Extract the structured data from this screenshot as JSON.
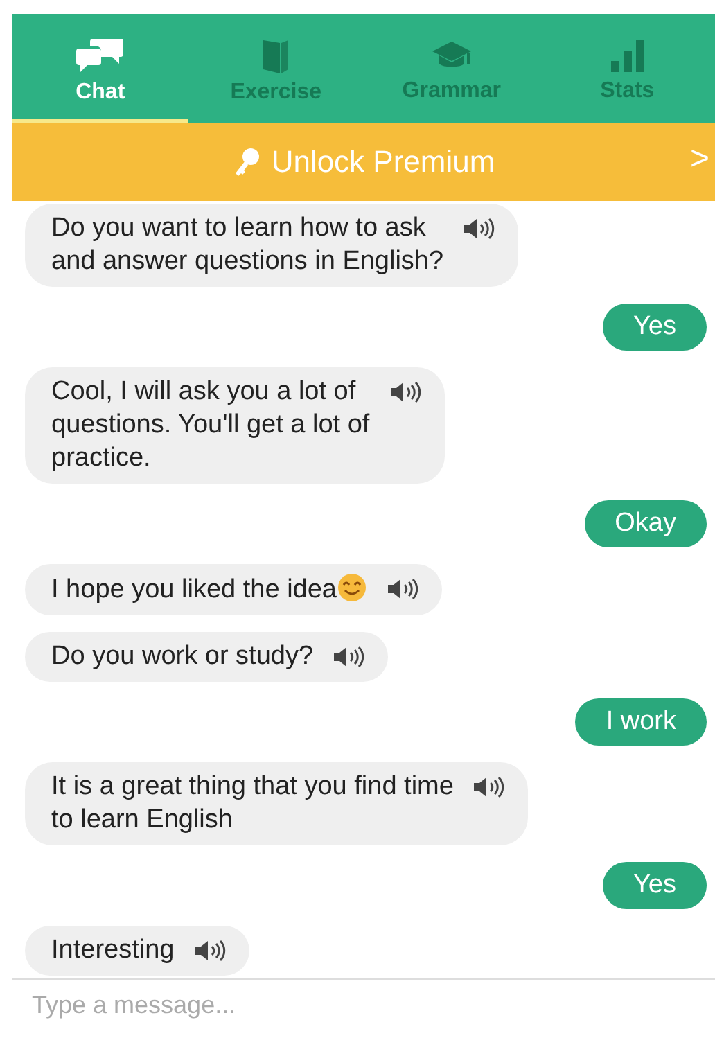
{
  "tabs": [
    {
      "label": "Chat",
      "selected": true
    },
    {
      "label": "Exercise",
      "selected": false
    },
    {
      "label": "Grammar",
      "selected": false
    },
    {
      "label": "Stats",
      "selected": false
    }
  ],
  "banner": {
    "label": "Unlock Premium",
    "arrow": ">"
  },
  "messages": [
    {
      "kind": "bot",
      "text": "Do you want to learn how to ask\nand answer questions in English?"
    },
    {
      "kind": "user",
      "text": "Yes"
    },
    {
      "kind": "bot",
      "text": "Cool, I will ask you a lot of\nquestions. You'll get a lot of\npractice."
    },
    {
      "kind": "user",
      "text": "Okay"
    },
    {
      "kind": "bot",
      "text": "I hope you liked the idea",
      "emoji": true
    },
    {
      "kind": "bot",
      "text": "Do you work or study?"
    },
    {
      "kind": "user",
      "text": "I work"
    },
    {
      "kind": "bot",
      "text": "It is a great thing that you find time\nto learn English"
    },
    {
      "kind": "user",
      "text": "Yes"
    },
    {
      "kind": "bot",
      "text": "Interesting"
    }
  ],
  "input": {
    "placeholder": "Type a message..."
  }
}
